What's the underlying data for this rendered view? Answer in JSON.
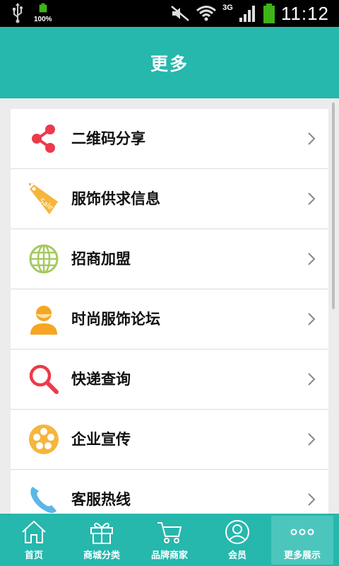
{
  "status_bar": {
    "battery_small_label": "100%",
    "network": "3G",
    "time": "11:12"
  },
  "header": {
    "title": "更多"
  },
  "list": {
    "items": [
      {
        "label": "二维码分享",
        "icon": "share-icon",
        "color": "#ec3a4b"
      },
      {
        "label": "服饰供求信息",
        "icon": "sale-tag-icon",
        "color": "#f5b63c"
      },
      {
        "label": "招商加盟",
        "icon": "globe-icon",
        "color": "#a6c95f"
      },
      {
        "label": "时尚服饰论坛",
        "icon": "user-avatar-icon",
        "color": "#f7a623"
      },
      {
        "label": "快递查询",
        "icon": "magnifier-icon",
        "color": "#ec3a4b"
      },
      {
        "label": "企业宣传",
        "icon": "film-reel-icon",
        "color": "#f5b63c"
      },
      {
        "label": "客服热线",
        "icon": "phone-icon",
        "color": "#5bb7e8"
      }
    ]
  },
  "tabbar": {
    "tabs": [
      {
        "label": "首页",
        "icon": "home-icon"
      },
      {
        "label": "商城分类",
        "icon": "gift-box-icon"
      },
      {
        "label": "品牌商家",
        "icon": "cart-icon"
      },
      {
        "label": "会员",
        "icon": "member-icon"
      },
      {
        "label": "更多展示",
        "icon": "more-dots-icon",
        "active": true
      }
    ]
  },
  "colors": {
    "accent": "#26b7ad",
    "active_tab": "#4cc6bd"
  }
}
